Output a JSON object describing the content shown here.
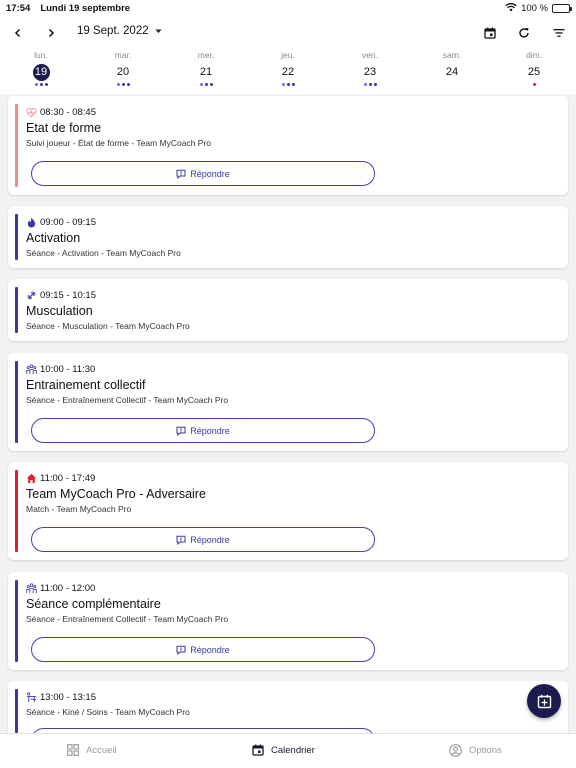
{
  "status_bar": {
    "time": "17:54",
    "date": "Lundi 19 septembre",
    "battery": "100 %"
  },
  "toolbar": {
    "month_label": "19 Sept. 2022"
  },
  "week": [
    {
      "name": "lun.",
      "num": "19",
      "selected": true,
      "dots": [
        "#8b5cf6",
        "#3b38a6",
        "#3b38a6"
      ]
    },
    {
      "name": "mar.",
      "num": "20",
      "selected": false,
      "dots": [
        "#8b5cf6",
        "#3b38a6",
        "#3b38a6"
      ]
    },
    {
      "name": "mer.",
      "num": "21",
      "selected": false,
      "dots": [
        "#8b5cf6",
        "#3b38a6",
        "#3b38a6"
      ]
    },
    {
      "name": "jeu.",
      "num": "22",
      "selected": false,
      "dots": [
        "#8b5cf6",
        "#3b38a6",
        "#3b38a6"
      ]
    },
    {
      "name": "ven.",
      "num": "23",
      "selected": false,
      "dots": [
        "#8b5cf6",
        "#3b38a6",
        "#3b38a6"
      ]
    },
    {
      "name": "sam.",
      "num": "24",
      "selected": false,
      "dots": []
    },
    {
      "name": "dim.",
      "num": "25",
      "selected": false,
      "dots": [
        "#e11d2e"
      ]
    }
  ],
  "events": [
    {
      "icon": "heart-pulse-icon",
      "time": "08:30 - 08:45",
      "title": "Etat de forme",
      "subtitle": "Suivi joueur - État de forme - Team MyCoach Pro",
      "color": "#f08a8a",
      "reply": true
    },
    {
      "icon": "flame-icon",
      "time": "09:00 - 09:15",
      "title": "Activation",
      "subtitle": "Séance - Activation - Team MyCoach Pro",
      "color": "#3b38a6",
      "reply": false
    },
    {
      "icon": "dumbbell-icon",
      "time": "09:15 - 10:15",
      "title": "Musculation",
      "subtitle": "Séance - Musculation - Team MyCoach Pro",
      "color": "#3b38a6",
      "reply": false
    },
    {
      "icon": "group-icon",
      "time": "10:00 - 11:30",
      "title": "Entrainement collectif",
      "subtitle": "Séance - Entraînement Collectif - Team MyCoach Pro",
      "color": "#3b38a6",
      "reply": true
    },
    {
      "icon": "home-icon",
      "time": "11:00 - 17:49",
      "title": "Team MyCoach Pro - Adversaire",
      "subtitle": "Match - Team MyCoach Pro",
      "color": "#e11d2e",
      "reply": true
    },
    {
      "icon": "group-icon",
      "time": "11:00 - 12:00",
      "title": "Séance complémentaire",
      "subtitle": "Séance - Entraînement Collectif - Team MyCoach Pro",
      "color": "#3b38a6",
      "reply": true
    },
    {
      "icon": "physio-icon",
      "time": "13:00 - 13:15",
      "title": "",
      "subtitle": "Séance - Kiné / Soins - Team MyCoach Pro",
      "color": "#3b38a6",
      "reply": true
    }
  ],
  "reply_label": "Répondre",
  "nav": {
    "home": "Accueil",
    "calendar": "Calendrier",
    "options": "Options"
  },
  "colors": {
    "accent": "#3b38a6",
    "dark": "#1d1b4d",
    "match": "#e11d2e",
    "wellness": "#f08a8a"
  }
}
